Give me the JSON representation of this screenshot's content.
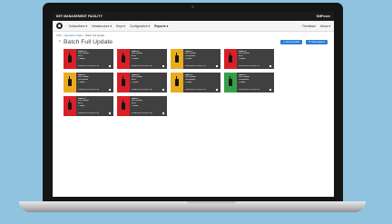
{
  "app": {
    "title": "KEY MANAGEMENT FACILITY",
    "user": "KMFuser"
  },
  "nav": {
    "items": [
      "Subscribers",
      "Infrastructure",
      "Keys",
      "Configuration",
      "Reports"
    ],
    "right_items": [
      "Feedback",
      "About"
    ]
  },
  "breadcrumb": [
    "KMF",
    "Operations Status",
    "Batch Full Update"
  ],
  "page": {
    "title": "Batch Full Update",
    "buttons": [
      "View by Units",
      "Show Agents"
    ]
  },
  "colors": {
    "red": "#d92027",
    "yellow": "#ebab1e",
    "green": "#34a047",
    "accent": "#2b7fd6"
  },
  "cards": [
    {
      "name": "Radio 15",
      "operation": "Full Update",
      "state": "Error",
      "detail": "1 failed",
      "date": "09/04/2018 10:18:41 PM",
      "status": "red"
    },
    {
      "name": "Radio 9",
      "operation": "Full Update",
      "state": "Error",
      "detail": "1 failed",
      "date": "09/04/2018 10:18:41 PM",
      "status": "red"
    },
    {
      "name": "Radio 1",
      "operation": "Full Update",
      "state": "Completed",
      "detail": "1 failed",
      "date": "09/04/2018 10:18:41 PM",
      "status": "yellow"
    },
    {
      "name": "Radio 8",
      "operation": "Full Update",
      "state": "Error",
      "detail": "1 failed",
      "date": "09/04/2018 10:18:41 PM",
      "status": "red"
    },
    {
      "name": "Radio 4",
      "operation": "Full Update",
      "state": "Completed",
      "detail": "1 failed",
      "date": "09/04/2018 10:18:41 PM",
      "status": "yellow"
    },
    {
      "name": "Radio 3",
      "operation": "Full Update",
      "state": "Error",
      "detail": "1 failed",
      "date": "09/04/2018 10:18:41 PM",
      "status": "red"
    },
    {
      "name": "Radio 2",
      "operation": "Full Update",
      "state": "Completed",
      "detail": "1 failed",
      "date": "09/04/2018 10:18:41 PM",
      "status": "yellow"
    },
    {
      "name": "Radio 5",
      "operation": "Full Update",
      "state": "Completed",
      "detail": "1 failed",
      "date": "09/04/2018 10:18:41 PM",
      "status": "green"
    },
    {
      "name": "Radio 6",
      "operation": "Full Update",
      "state": "Error",
      "detail": "1 failed",
      "date": "09/04/2018 10:18:41 PM",
      "status": "red"
    },
    {
      "name": "Radio 7",
      "operation": "Full Update",
      "state": "Error",
      "detail": "1 failed",
      "date": "09/04/2018 10:18:41 PM",
      "status": "red"
    }
  ]
}
